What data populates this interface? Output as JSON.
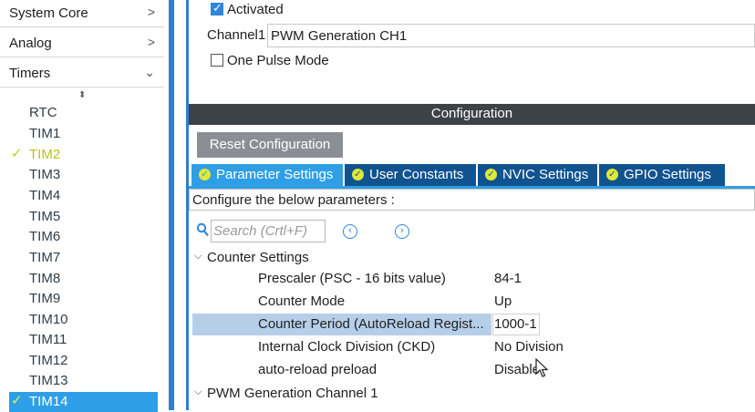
{
  "sidebar": {
    "categories": [
      {
        "label": "System Core",
        "chevron": ">"
      },
      {
        "label": "Analog",
        "chevron": ">"
      },
      {
        "label": "Timers",
        "chevron": "v"
      }
    ],
    "timers": [
      {
        "label": "RTC",
        "enabled": false,
        "selected": false
      },
      {
        "label": "TIM1",
        "enabled": false,
        "selected": false
      },
      {
        "label": "TIM2",
        "enabled": true,
        "selected": false
      },
      {
        "label": "TIM3",
        "enabled": false,
        "selected": false
      },
      {
        "label": "TIM4",
        "enabled": false,
        "selected": false
      },
      {
        "label": "TIM5",
        "enabled": false,
        "selected": false
      },
      {
        "label": "TIM6",
        "enabled": false,
        "selected": false
      },
      {
        "label": "TIM7",
        "enabled": false,
        "selected": false
      },
      {
        "label": "TIM8",
        "enabled": false,
        "selected": false
      },
      {
        "label": "TIM9",
        "enabled": false,
        "selected": false
      },
      {
        "label": "TIM10",
        "enabled": false,
        "selected": false
      },
      {
        "label": "TIM11",
        "enabled": false,
        "selected": false
      },
      {
        "label": "TIM12",
        "enabled": false,
        "selected": false
      },
      {
        "label": "TIM13",
        "enabled": false,
        "selected": false
      },
      {
        "label": "TIM14",
        "enabled": true,
        "selected": true
      }
    ],
    "check_glyph": "✓"
  },
  "mode": {
    "activated_label": "Activated",
    "activated_checked": true,
    "channel1_label": "Channel1",
    "channel1_value": "PWM Generation CH1",
    "one_pulse_label": "One Pulse Mode",
    "one_pulse_checked": false
  },
  "config": {
    "header": "Configuration",
    "reset_button": "Reset Configuration",
    "tabs": [
      {
        "label": "Parameter Settings",
        "active": true
      },
      {
        "label": "User Constants",
        "active": false
      },
      {
        "label": "NVIC Settings",
        "active": false
      },
      {
        "label": "GPIO Settings",
        "active": false
      }
    ],
    "hint": "Configure the below parameters :",
    "search_placeholder": "Search (Crtl+F)",
    "groups": {
      "counter": "Counter Settings",
      "pwm": "PWM Generation Channel 1"
    },
    "params": [
      {
        "name": "Prescaler (PSC - 16 bits value)",
        "value": "84-1",
        "selected": false
      },
      {
        "name": "Counter Mode",
        "value": "Up",
        "selected": false
      },
      {
        "name": "Counter Period (AutoReload Regist...",
        "value": "1000-1",
        "selected": true
      },
      {
        "name": "Internal Clock Division (CKD)",
        "value": "No Division",
        "selected": false
      },
      {
        "name": "auto-reload preload",
        "value": "Disable",
        "selected": false
      }
    ]
  },
  "colors": {
    "selected_item": "#2e9fe6",
    "tab_active": "#2e9fe6",
    "tab_inactive": "#10538f",
    "header_bg": "#3d4248",
    "enabled_timer": "#b7c21b",
    "row_selected": "#b5cfe9"
  }
}
